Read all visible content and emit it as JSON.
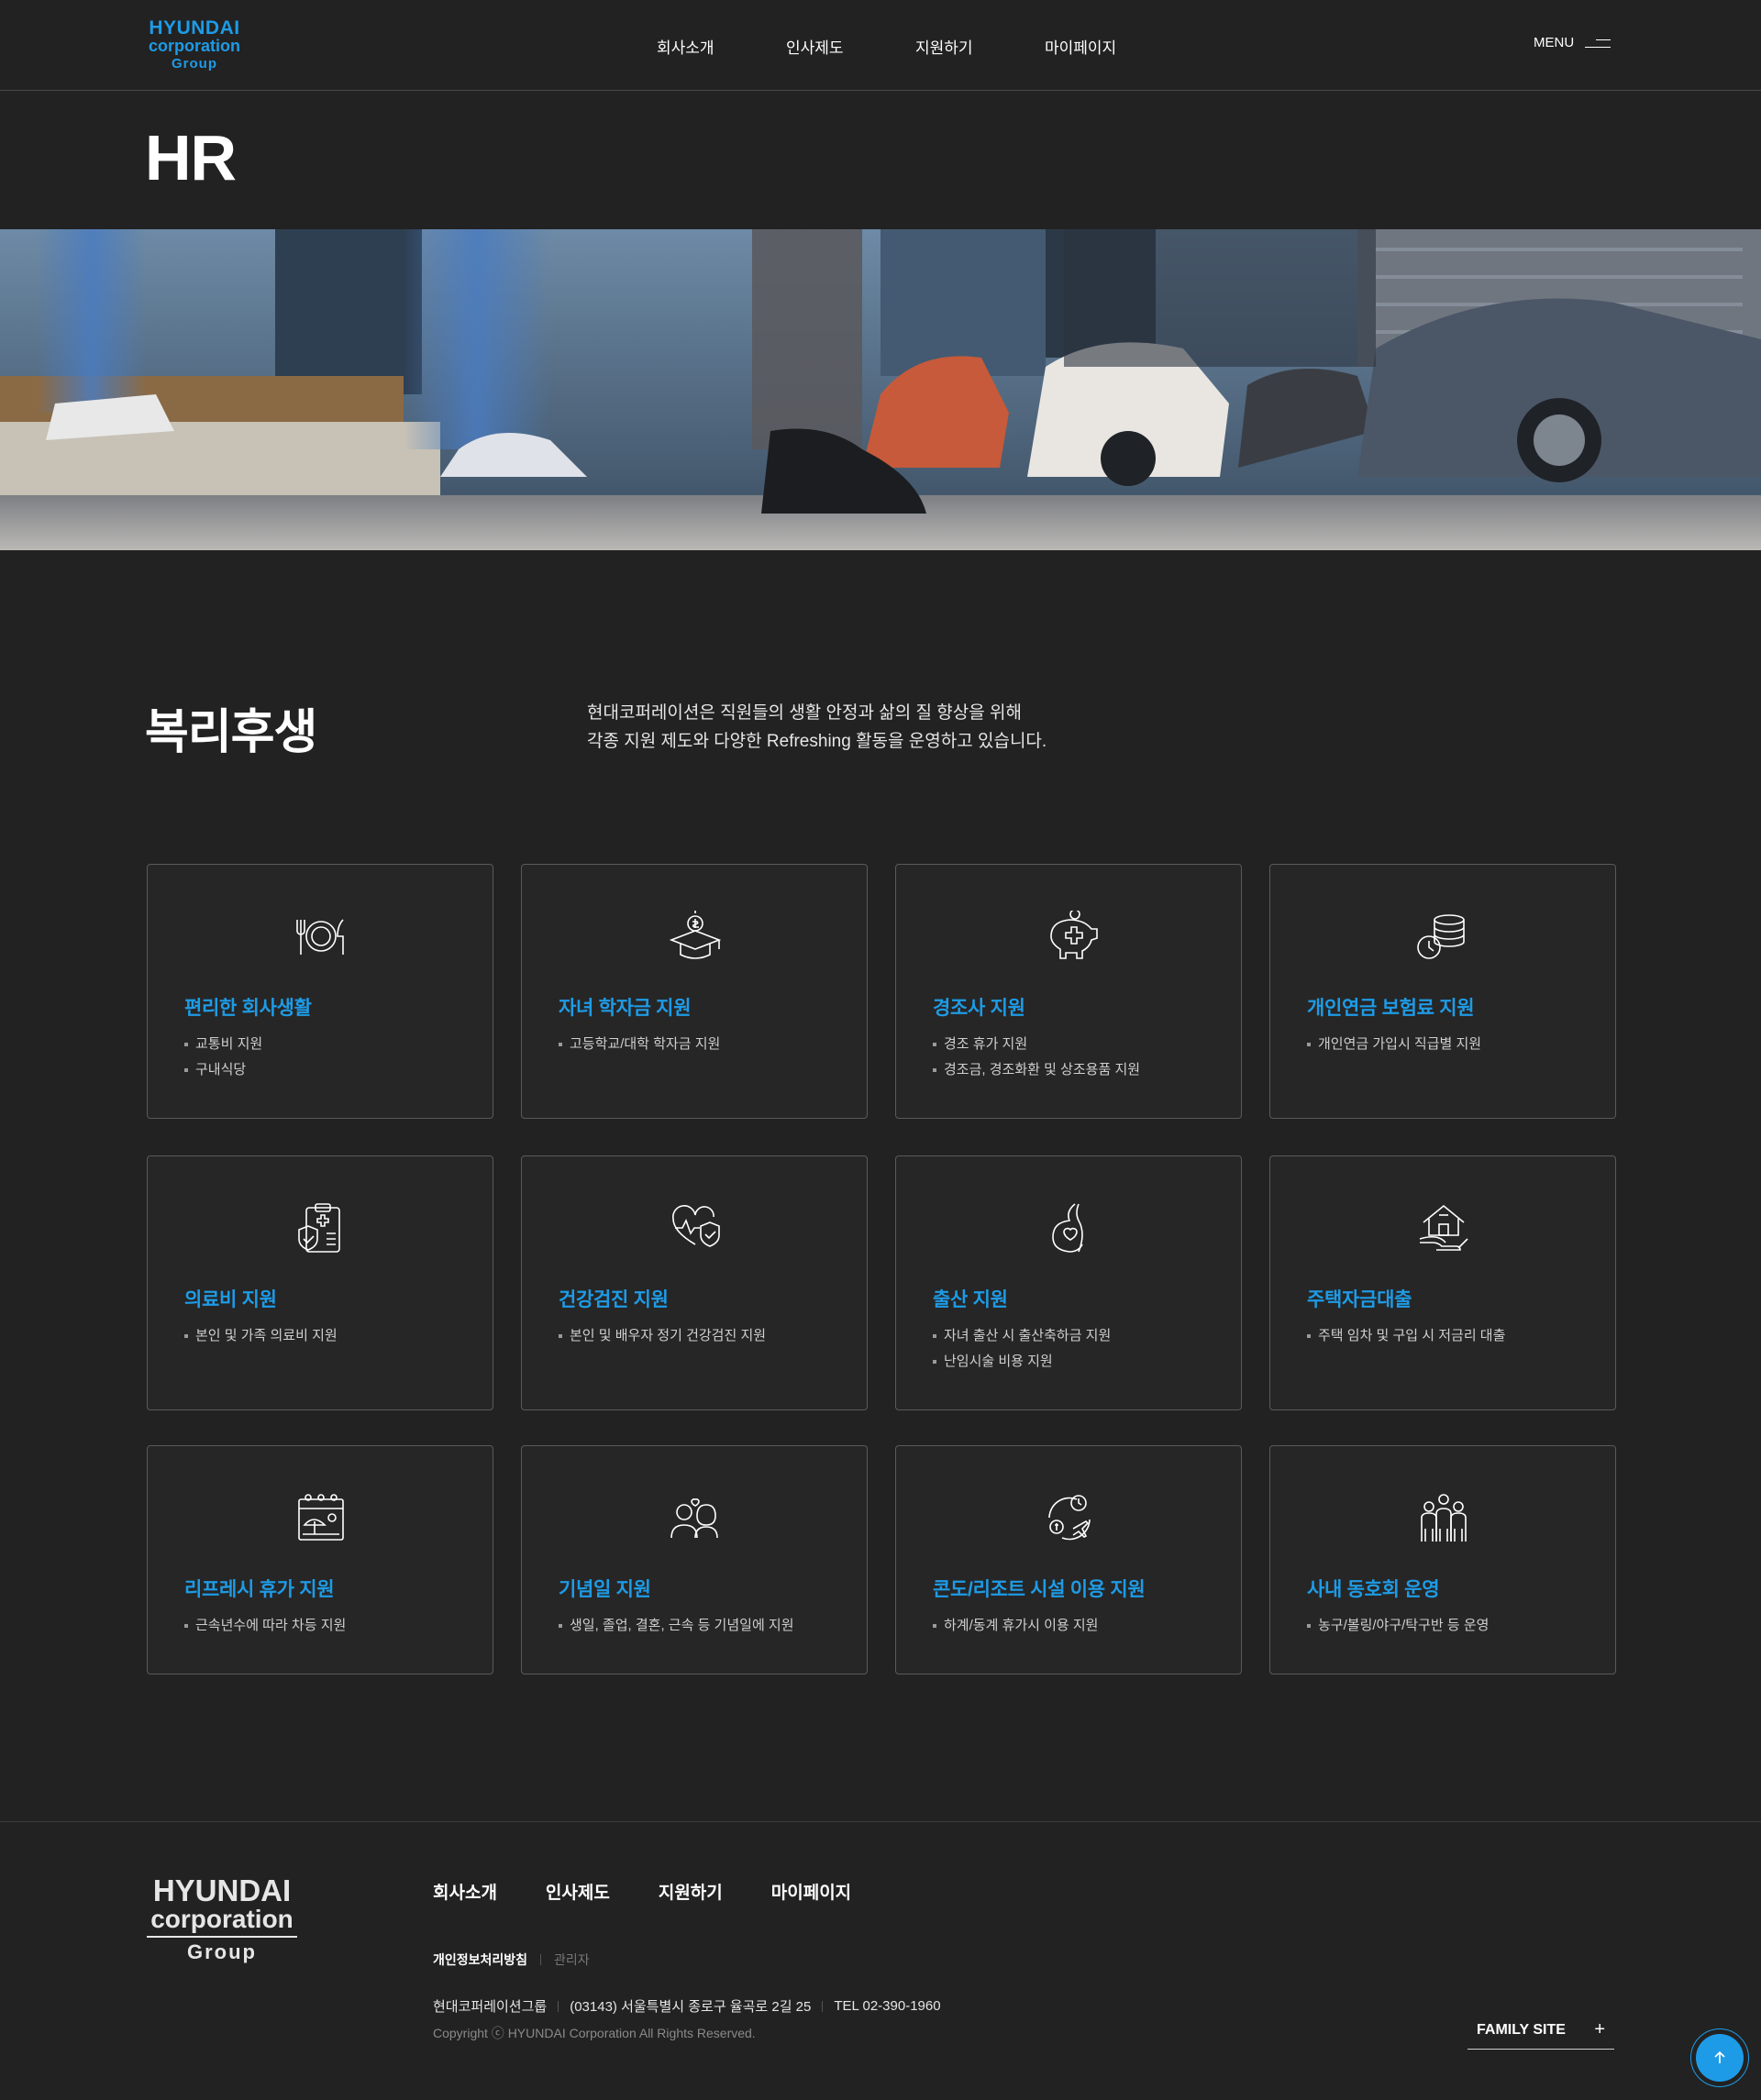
{
  "header": {
    "logo": {
      "line1": "HYUNDAI",
      "line2": "corporation",
      "line3": "Group"
    },
    "nav": [
      "회사소개",
      "인사제도",
      "지원하기",
      "마이페이지"
    ],
    "menu_label": "MENU"
  },
  "page_title": "HR",
  "section": {
    "title": "복리후생",
    "intro_line1": "현대코퍼레이션은 직원들의 생활 안정과 삶의 질 향상을 위해",
    "intro_line2": "각종 지원 제도와 다양한 Refreshing 활동을 운영하고 있습니다."
  },
  "cards": [
    {
      "icon": "dining-icon",
      "title": "편리한 회사생활",
      "items": [
        "교통비 지원",
        "구내식당"
      ]
    },
    {
      "icon": "graduation-money-icon",
      "title": "자녀 학자금 지원",
      "items": [
        "고등학교/대학 학자금 지원"
      ]
    },
    {
      "icon": "piggy-bank-icon",
      "title": "경조사 지원",
      "items": [
        "경조 휴가 지원",
        "경조금, 경조화환 및 상조용품 지원"
      ]
    },
    {
      "icon": "coins-clock-icon",
      "title": "개인연금 보험료 지원",
      "items": [
        "개인연금 가입시 직급별 지원"
      ]
    },
    {
      "icon": "medical-clipboard-icon",
      "title": "의료비 지원",
      "items": [
        "본인 및 가족 의료비 지원"
      ]
    },
    {
      "icon": "heart-shield-icon",
      "title": "건강검진 지원",
      "items": [
        "본인 및 배우자 정기 건강검진 지원"
      ]
    },
    {
      "icon": "pregnancy-icon",
      "title": "출산 지원",
      "items": [
        "자녀 출산 시 출산축하금 지원",
        "난임시술 비용 지원"
      ]
    },
    {
      "icon": "house-hand-icon",
      "title": "주택자금대출",
      "items": [
        "주택 임차 및 구입 시 저금리 대출"
      ]
    },
    {
      "icon": "calendar-beach-icon",
      "title": "리프레시 휴가 지원",
      "items": [
        "근속년수에 따라 차등 지원"
      ]
    },
    {
      "icon": "couple-icon",
      "title": "기념일 지원",
      "items": [
        "생일, 졸업, 결혼, 근속 등 기념일에 지원"
      ]
    },
    {
      "icon": "resort-travel-icon",
      "title": "콘도/리조트 시설 이용 지원",
      "items": [
        "하계/동계 휴가시 이용 지원"
      ]
    },
    {
      "icon": "club-group-icon",
      "title": "사내 동호회 운영",
      "items": [
        "농구/볼링/야구/탁구반 등 운영"
      ]
    }
  ],
  "footer": {
    "logo": {
      "line1": "HYUNDAI",
      "line2": "corporation",
      "line3": "Group"
    },
    "nav": [
      "회사소개",
      "인사제도",
      "지원하기",
      "마이페이지"
    ],
    "privacy": "개인정보처리방침",
    "admin": "관리자",
    "company": "현대코퍼레이션그룹",
    "address": "(03143) 서울특별시 종로구 율곡로 2길 25",
    "tel": "TEL 02-390-1960",
    "copyright": "Copyright ⓒ HYUNDAI Corporation All Rights Reserved.",
    "family_site": "FAMILY SITE"
  },
  "colors": {
    "accent": "#1e9be6",
    "background": "#222222",
    "card_border": "#5a5a5a"
  }
}
